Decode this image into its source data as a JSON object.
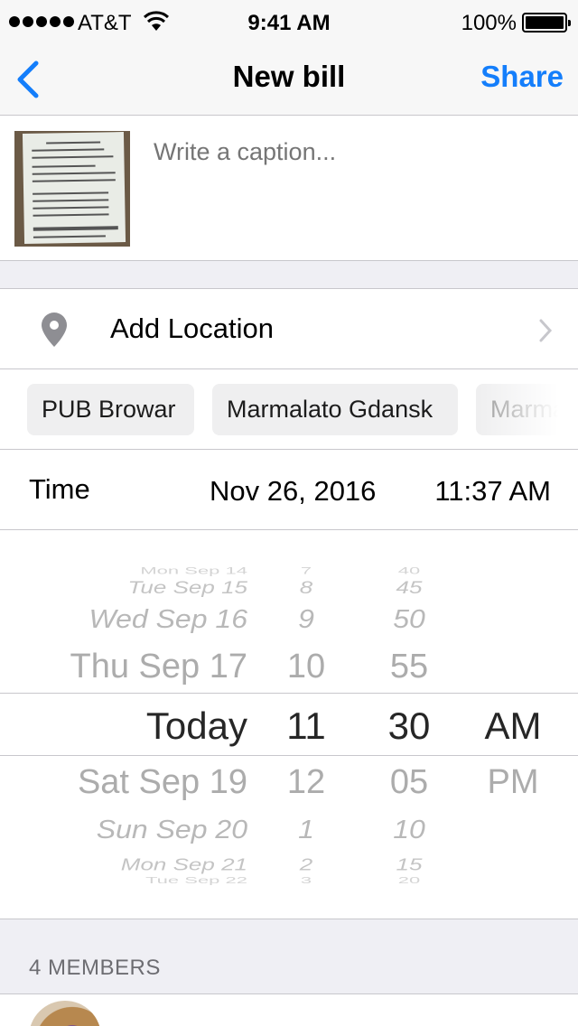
{
  "status_bar": {
    "carrier": "AT&T",
    "time": "9:41 AM",
    "battery": "100%"
  },
  "nav": {
    "title": "New bill",
    "share_label": "Share"
  },
  "caption": {
    "placeholder": "Write a caption..."
  },
  "location": {
    "label": "Add Location"
  },
  "places": [
    "PUB Browar",
    "Marmalato Gdansk",
    "Marmalato"
  ],
  "time_row": {
    "label": "Time",
    "date": "Nov 26, 2016",
    "time": "11:37 AM"
  },
  "picker": {
    "days": [
      "Mon Sep 14",
      "Tue Sep 15",
      "Wed Sep 16",
      "Thu Sep 17",
      "Today",
      "Sat Sep 19",
      "Sun Sep 20",
      "Mon Sep 21",
      "Tue Sep 22"
    ],
    "hours": [
      "7",
      "8",
      "9",
      "10",
      "11",
      "12",
      "1",
      "2",
      "3"
    ],
    "minutes": [
      "40",
      "45",
      "50",
      "55",
      "30",
      "05",
      "10",
      "15",
      "20"
    ],
    "ampm": [
      "AM",
      "PM"
    ]
  },
  "members": {
    "header": "4 MEMBERS"
  },
  "colors": {
    "accent": "#147efb",
    "group_background": "#efeff4",
    "separator": "#c8c7cc"
  }
}
